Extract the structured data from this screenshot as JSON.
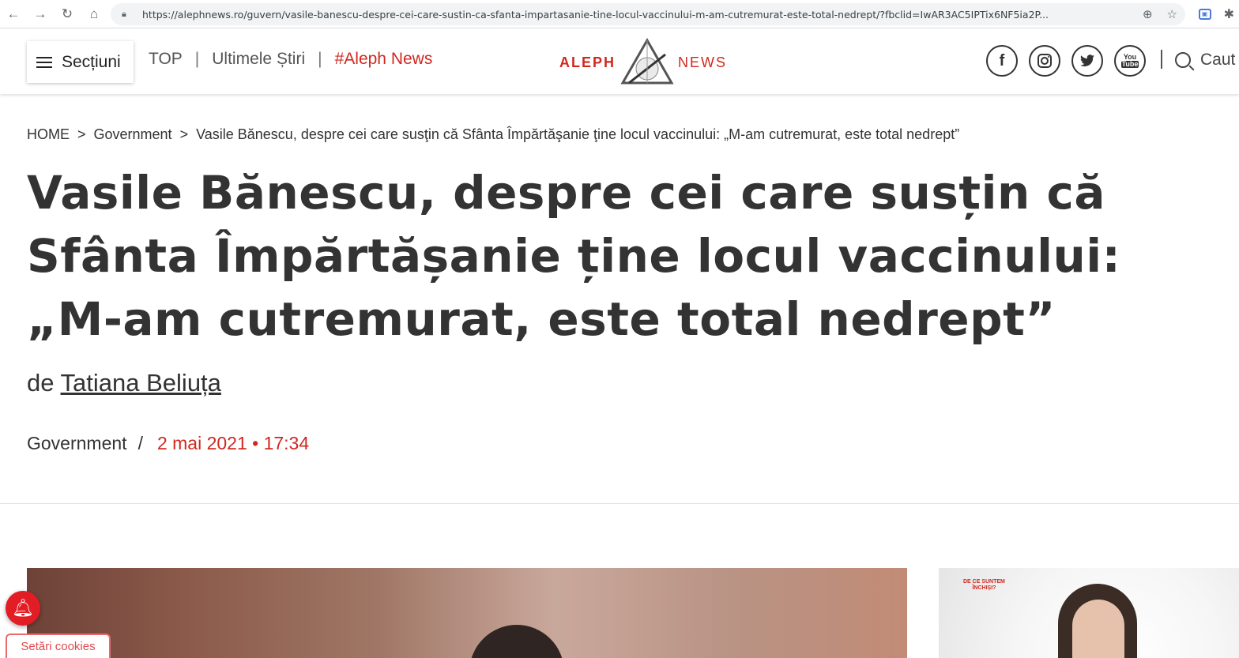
{
  "browser": {
    "url": "https://alephnews.ro/guvern/vasile-banescu-despre-cei-care-sustin-ca-sfanta-impartasanie-tine-locul-vaccinului-m-am-cutremurat-este-total-nedrept/?fbclid=IwAR3AC5IPTix6NF5ia2P...",
    "icons": [
      "back-icon",
      "forward-icon",
      "reload-icon",
      "home-icon",
      "lock-icon",
      "zoom-icon",
      "star-icon",
      "extension-icon",
      "puzzle-icon"
    ]
  },
  "header": {
    "sections_label": "Secțiuni",
    "nav": [
      {
        "label": "TOP"
      },
      {
        "label": "Ultimele Știri"
      },
      {
        "label": "#Aleph News"
      }
    ],
    "separator": "|",
    "logo_left": "ALEPH",
    "logo_right": "NEWS",
    "social": [
      "facebook-icon",
      "instagram-icon",
      "twitter-icon",
      "youtube-icon"
    ],
    "youtube_text_top": "You",
    "youtube_text_bottom": "Tube",
    "search_label": "Caut"
  },
  "article": {
    "breadcrumb": [
      {
        "label": "HOME"
      },
      {
        "label": "Government"
      },
      {
        "label": "Vasile Bănescu, despre cei care susţin că Sfânta Împărtăşanie ţine locul vaccinului: „M-am cutremurat, este total nedrept”"
      }
    ],
    "breadcrumb_sep": ">",
    "headline": "Vasile Bănescu, despre cei care susțin că Sfânta Împărtășanie ține locul vaccinului: „M-am cutremurat, este total nedrept”",
    "byline_prefix": "de",
    "author": "Tatiana Beliuța",
    "category": "Government",
    "meta_sep": "/",
    "date": "2 mai 2021 • 17:34"
  },
  "ad": {
    "label_line1": "DE CE SUNTEM",
    "label_line2": "ÎNCHIȘI?"
  },
  "cookies_label": "Setări cookies",
  "colors": {
    "accent": "#d0281f",
    "text": "#333333",
    "bell": "#e21d25"
  }
}
